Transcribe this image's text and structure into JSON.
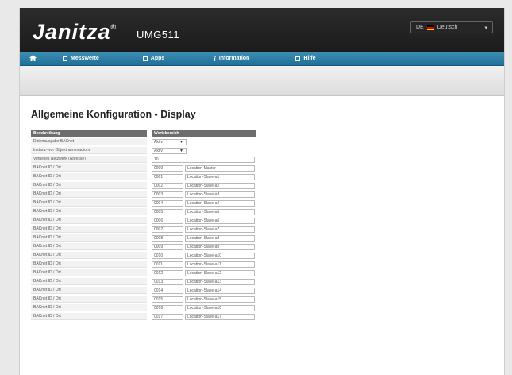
{
  "header": {
    "brand": "Janitza",
    "brand_mark": "®",
    "model": "UMG511",
    "language": {
      "code": "DE",
      "label": "Deutsch"
    }
  },
  "nav": {
    "items": [
      {
        "label": "Messwerte",
        "icon": "square-icon"
      },
      {
        "label": "Apps",
        "icon": "grid-icon"
      },
      {
        "label": "Information",
        "icon": "info-icon"
      },
      {
        "label": "Hilfe",
        "icon": "square-icon"
      }
    ]
  },
  "page": {
    "title": "Allgemeine Konfiguration - Display"
  },
  "table": {
    "headers": [
      "Beschreibung",
      "Wertebereich"
    ],
    "settings": [
      {
        "label": "Datenausgabe BACnet",
        "value": "Aktiv"
      },
      {
        "label": "Instanz- vor Objektnamenautom.",
        "value": "Aktiv"
      }
    ],
    "network": {
      "label": "Virtuelles Netzwerk (Adresse)",
      "value": "10"
    },
    "rows": [
      {
        "label": "BACnet ID / Ort",
        "id": "0000",
        "loc": "Location-Master"
      },
      {
        "label": "BACnet ID / Ort",
        "id": "0001",
        "loc": "Location-Slave-a1"
      },
      {
        "label": "BACnet ID / Ort",
        "id": "0002",
        "loc": "Location-Slave-a2"
      },
      {
        "label": "BACnet ID / Ort",
        "id": "0003",
        "loc": "Location-Slave-a3"
      },
      {
        "label": "BACnet ID / Ort",
        "id": "0004",
        "loc": "Location-Slave-a4"
      },
      {
        "label": "BACnet ID / Ort",
        "id": "0005",
        "loc": "Location-Slave-a5"
      },
      {
        "label": "BACnet ID / Ort",
        "id": "0006",
        "loc": "Location-Slave-a6"
      },
      {
        "label": "BACnet ID / Ort",
        "id": "0007",
        "loc": "Location-Slave-a7"
      },
      {
        "label": "BACnet ID / Ort",
        "id": "0008",
        "loc": "Location-Slave-a8"
      },
      {
        "label": "BACnet ID / Ort",
        "id": "0009",
        "loc": "Location-Slave-a9"
      },
      {
        "label": "BACnet ID / Ort",
        "id": "0010",
        "loc": "Location-Slave-a10"
      },
      {
        "label": "BACnet ID / Ort",
        "id": "0011",
        "loc": "Location-Slave-a11"
      },
      {
        "label": "BACnet ID / Ort",
        "id": "0012",
        "loc": "Location-Slave-a12"
      },
      {
        "label": "BACnet ID / Ort",
        "id": "0013",
        "loc": "Location-Slave-a13"
      },
      {
        "label": "BACnet ID / Ort",
        "id": "0014",
        "loc": "Location-Slave-a14"
      },
      {
        "label": "BACnet ID / Ort",
        "id": "0015",
        "loc": "Location-Slave-a15"
      },
      {
        "label": "BACnet ID / Ort",
        "id": "0016",
        "loc": "Location-Slave-a16"
      },
      {
        "label": "BACnet ID / Ort",
        "id": "0017",
        "loc": "Location-Slave-a17"
      }
    ]
  }
}
